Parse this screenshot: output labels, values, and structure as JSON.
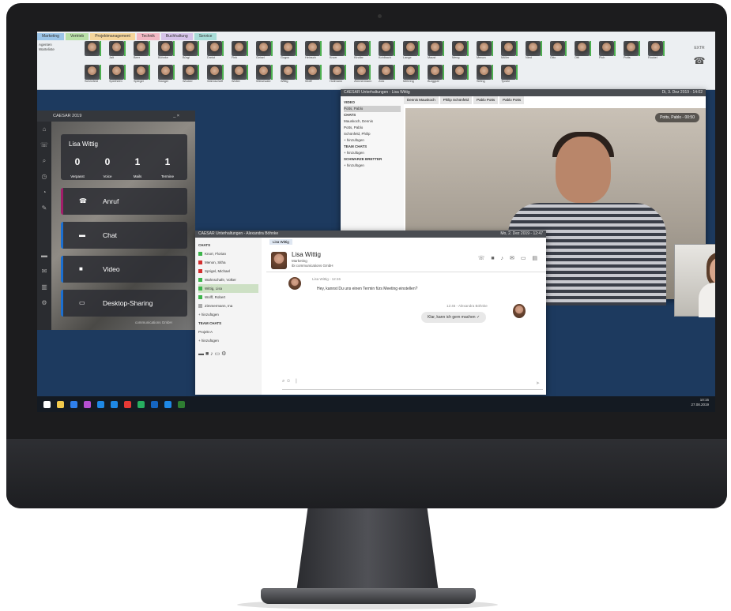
{
  "toolbar": {
    "tabs": [
      "Marketing",
      "Vertrieb",
      "Projektmanagement",
      "Technik",
      "Buchhaltung",
      "Service"
    ],
    "left_labels": [
      "Agenten",
      "Warteliste"
    ],
    "contacts_row1": [
      "",
      "Jalt",
      "Beer",
      "Böhnke",
      "Bürgi",
      "Dreist",
      "Fink",
      "Geisel",
      "Gogus",
      "Heinsch",
      "Knorr",
      "Kindler",
      "Kohlbach",
      "Lange",
      "Maust",
      "Meng",
      "Menon",
      "Müller",
      "Nied",
      "Otto",
      "Ottl",
      "Pich",
      "Potts",
      "Rockel"
    ],
    "contacts_row2": [
      "Schönfeld",
      "Spielhelm",
      "Spiegel",
      "Stanger",
      "Wocker",
      "Wahnschaff",
      "Wolter",
      "Wiesewald",
      "Wittig",
      "Wolff",
      "Hollmann",
      "Zimmermann",
      "Zotz",
      "Mehring",
      "Burggraf",
      "",
      "Sirling",
      "Tjostle"
    ],
    "phone_label": "EXTR"
  },
  "dialer": {
    "title": "CAESAR 2019",
    "name": "Lisa Wittig",
    "stats": [
      {
        "value": "0",
        "label": "Verpasst"
      },
      {
        "value": "0",
        "label": "Voice"
      },
      {
        "value": "1",
        "label": "Mails"
      },
      {
        "value": "1",
        "label": "Termine"
      }
    ],
    "buttons": [
      {
        "label": "Anruf",
        "color": "#a11d6a"
      },
      {
        "label": "Chat",
        "color": "#1b6fd1"
      },
      {
        "label": "Video",
        "color": "#1b6fd1"
      },
      {
        "label": "Desktop-Sharing",
        "color": "#1b6fd1"
      }
    ],
    "footer": "communications GmbH"
  },
  "video_window": {
    "title": "CAESAR Unterhaltungen - Lisa Wittig",
    "datetime": "Di, 3. Dez 2019 - 14:02",
    "tabs": [
      "Dennis Mauskoch",
      "Philip Schönfeld",
      "Pablo Potts",
      "Pablo Potts"
    ],
    "sidebar": [
      "VIDEO",
      "Potts, Pablo",
      "CHATS",
      "Mauskoch, Dennis",
      "Potts, Pablo",
      "Schönfeld, Philip",
      "+ hinzufügen",
      "TEAM CHATS",
      "+ hinzufügen",
      "SCHWARZE BRETTER",
      "+ hinzufügen"
    ],
    "badge": "Potts, Pablo - 00:50"
  },
  "chat_window": {
    "title": "CAESAR Unterhaltungen - Alexandra Böhnke",
    "datetime": "Mo, 2. Dez 2019 - 12:47",
    "tab": "Lisa Wittig",
    "list_header": "CHATS",
    "items": [
      {
        "name": "Knorr, Florian",
        "color": "#3cb44b"
      },
      {
        "name": "Menon, Sitha",
        "color": "#d32f2f"
      },
      {
        "name": "Sprigel, Michael",
        "color": "#d32f2f"
      },
      {
        "name": "Wahnschafe, Volker",
        "color": "#3cb44b"
      },
      {
        "name": "Wittig, Lisa",
        "color": "#3cb44b"
      },
      {
        "name": "Wolff, Robert",
        "color": "#3cb44b"
      },
      {
        "name": "Zimmermann, Ina",
        "color": "#aaaaaa"
      }
    ],
    "add": "+ hinzufügen",
    "team_header": "TEAM CHATS",
    "team_item": "Projekt A",
    "team_add": "+ hinzufügen",
    "contact_name": "Lisa Wittig",
    "contact_dept": "Marketing",
    "contact_company": "ibi communications GmbH",
    "msg1_meta": "Lisa Wittig - 12:46",
    "msg1_text": "Hey, kannst Du uns einen Termin fürs Meeting einstellen?",
    "msg2_meta": "12:46 - Alexandra Böhnke",
    "msg2_text": "Klar, kann ich gern machen ✓"
  },
  "taskbar": {
    "time": "10:15",
    "date": "27.08.2019"
  }
}
